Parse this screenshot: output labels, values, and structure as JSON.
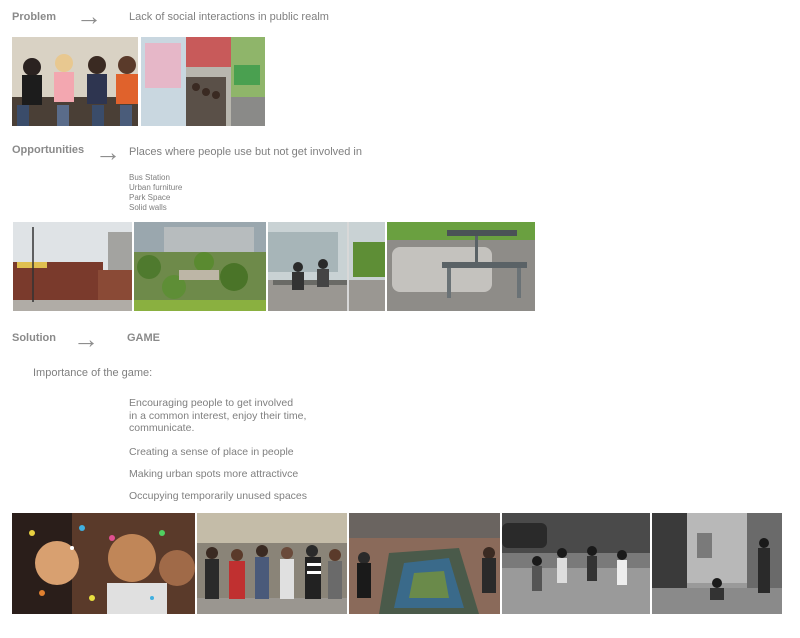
{
  "problem": {
    "label": "Problem",
    "text": "Lack of social interactions in public realm"
  },
  "opportunities": {
    "label": "Opportunities",
    "text": "Places where people use but not get involved in",
    "items": [
      "Bus Station",
      "Urban furniture",
      "Park Space",
      "Solid walls"
    ]
  },
  "solution": {
    "label": "Solution",
    "text": "GAME"
  },
  "importance": {
    "title": "Importance of the game:",
    "item1_lines": [
      "Encouraging people to get involved",
      "in a common interest, enjoy their time,",
      "communicate."
    ],
    "item2": "Creating a sense of place in people",
    "item3": "Making urban spots more attractivce",
    "item4": "Occupying temporarily unused spaces"
  },
  "icons": {
    "arrow": "→"
  }
}
